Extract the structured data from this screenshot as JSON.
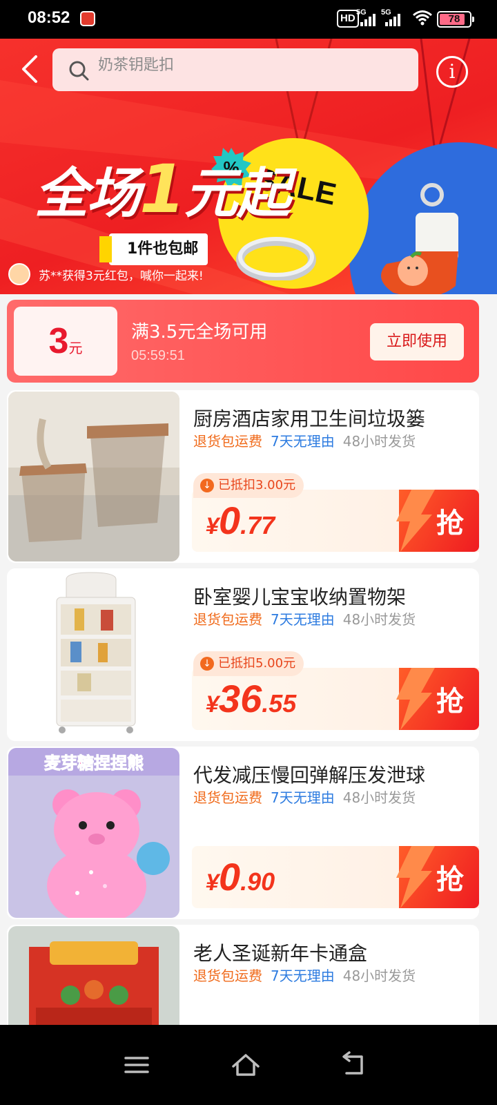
{
  "status_bar": {
    "time": "08:52",
    "hd_label": "HD",
    "signal_1_label": "5G",
    "signal_2_label": "5G",
    "battery": "78"
  },
  "header": {
    "search_placeholder": "奶茶钥匙扣"
  },
  "banner": {
    "headline_part1": "全场",
    "headline_big": "1",
    "headline_part2": "元起",
    "subline": "1件也包邮",
    "sale_text": "SALE",
    "notice": "苏**获得3元红包，喊你一起来!"
  },
  "coupon": {
    "amount": "3",
    "unit": "元",
    "title": "满3.5元全场可用",
    "timer": "05:59:51",
    "button": "立即使用"
  },
  "tags": {
    "return_shipping": "退货包运费",
    "seven_days": "7天无理由",
    "ship_48h": "48小时发货"
  },
  "products": [
    {
      "title": "厨房酒店家用卫生间垃圾篓",
      "deduct": "已抵扣3.00元",
      "currency": "¥",
      "price_int": "0",
      "price_dec": ".77",
      "button": "抢"
    },
    {
      "title": "卧室婴儿宝宝收纳置物架",
      "deduct": "已抵扣5.00元",
      "currency": "¥",
      "price_int": "36",
      "price_dec": ".55",
      "button": "抢"
    },
    {
      "title": "代发减压慢回弹解压发泄球",
      "currency": "¥",
      "price_int": "0",
      "price_dec": ".90",
      "button": "抢",
      "image_text": "麦芽糖捏捏熊"
    },
    {
      "title": "老人圣诞新年卡通盒"
    }
  ],
  "colors": {
    "brand_red": "#ee1f22",
    "price_red": "#f3341c",
    "tag_orange": "#f06a1a",
    "tag_blue": "#2c7be0"
  }
}
